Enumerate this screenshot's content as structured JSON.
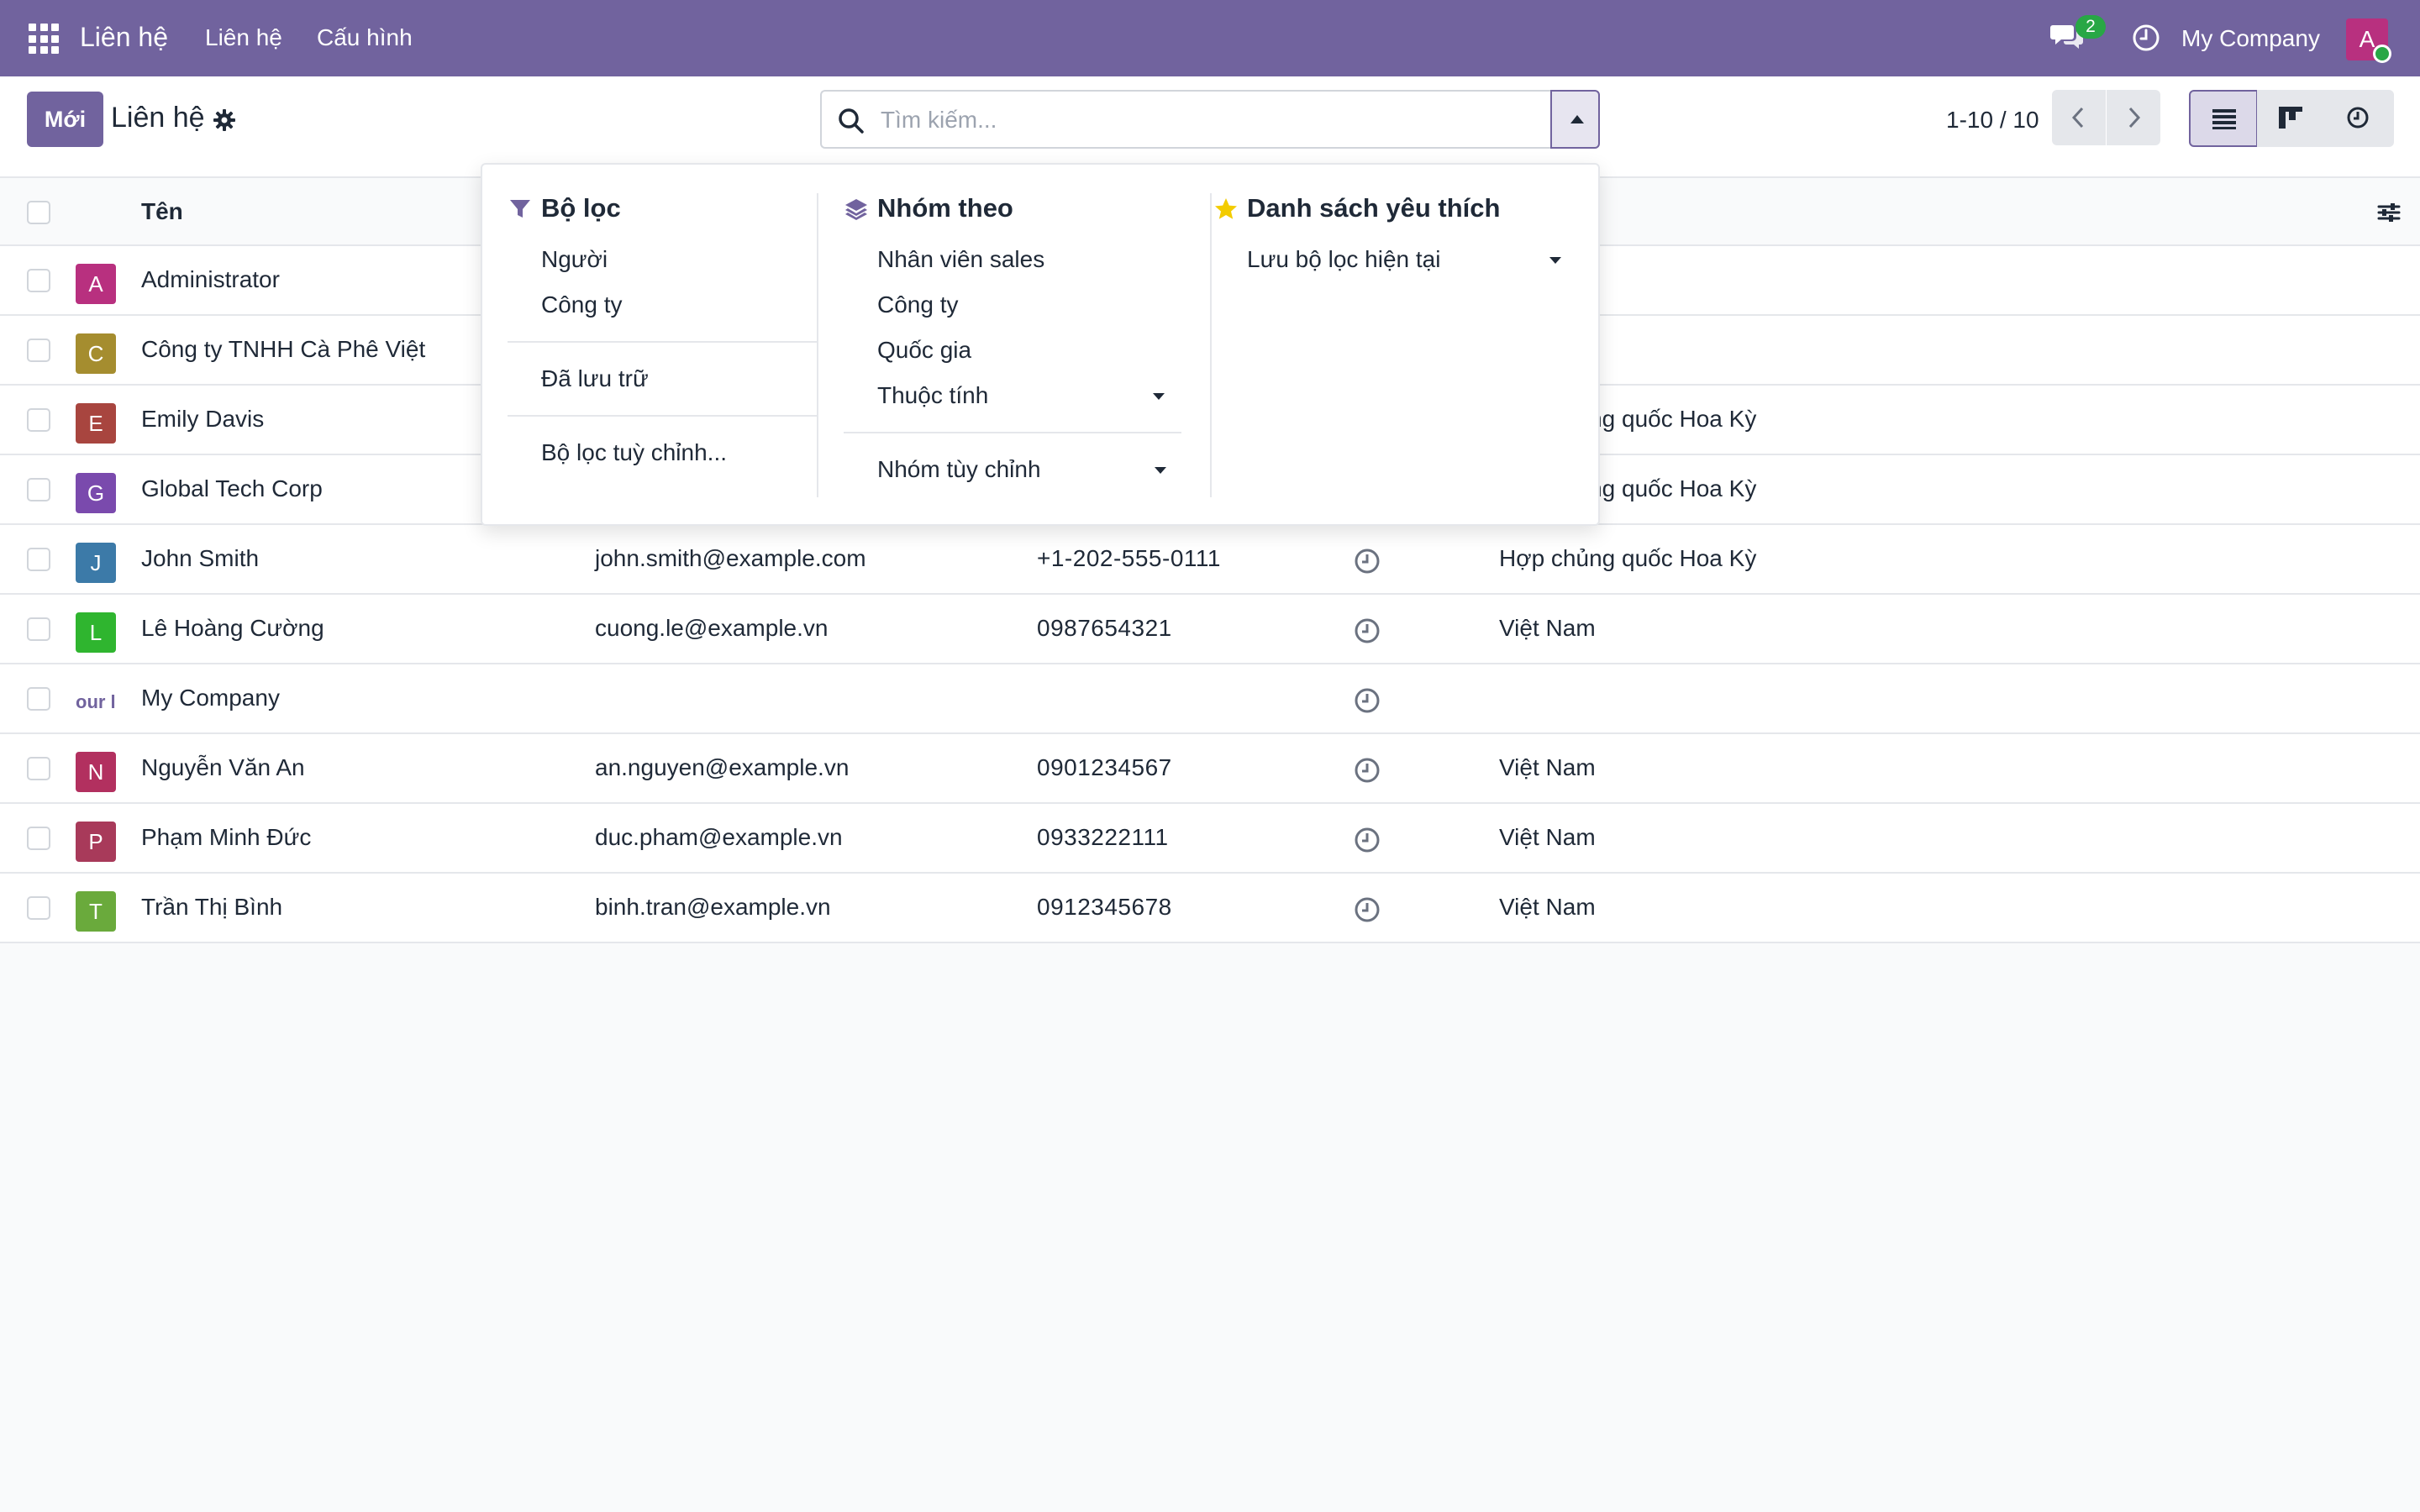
{
  "navbar": {
    "brand": "Liên hệ",
    "menu": [
      "Liên hệ",
      "Cấu hình"
    ],
    "chat_badge": "2",
    "company": "My Company",
    "user_initial": "A"
  },
  "control_panel": {
    "new_label": "Mới",
    "title": "Liên hệ",
    "search_placeholder": "Tìm kiếm...",
    "pager": "1-10 / 10"
  },
  "table": {
    "header_name": "Tên",
    "rows": [
      {
        "initial": "A",
        "color": "#b8307f",
        "name": "Administrator",
        "email": "",
        "phone": "",
        "country": "",
        "activity": false
      },
      {
        "initial": "C",
        "color": "#a58d2f",
        "name": "Công ty TNHH Cà Phê Việt",
        "email": "",
        "phone": "",
        "country": "",
        "activity": false
      },
      {
        "initial": "E",
        "color": "#a8453f",
        "name": "Emily Davis",
        "email": "",
        "phone": "",
        "country": "Hợp chủng quốc Hoa Kỳ",
        "activity": false
      },
      {
        "initial": "G",
        "color": "#7a4aad",
        "name": "Global Tech Corp",
        "email": "",
        "phone": "",
        "country": "Hợp chủng quốc Hoa Kỳ",
        "activity": false
      },
      {
        "initial": "J",
        "color": "#3c7aa8",
        "name": "John Smith",
        "email": "john.smith@example.com",
        "phone": "+1-202-555-0111",
        "country": "Hợp chủng quốc Hoa Kỳ",
        "activity": true
      },
      {
        "initial": "L",
        "color": "#2fb52f",
        "name": "Lê Hoàng Cường",
        "email": "cuong.le@example.vn",
        "phone": "0987654321",
        "country": "Việt Nam",
        "activity": true
      },
      {
        "initial": "our l",
        "color": "logo",
        "name": "My Company",
        "email": "",
        "phone": "",
        "country": "",
        "activity": true
      },
      {
        "initial": "N",
        "color": "#b2305f",
        "name": "Nguyễn Văn An",
        "email": "an.nguyen@example.vn",
        "phone": "0901234567",
        "country": "Việt Nam",
        "activity": true
      },
      {
        "initial": "P",
        "color": "#a83a5a",
        "name": "Phạm Minh Đức",
        "email": "duc.pham@example.vn",
        "phone": "0933222111",
        "country": "Việt Nam",
        "activity": true
      },
      {
        "initial": "T",
        "color": "#6aaa3c",
        "name": "Trần Thị Bình",
        "email": "binh.tran@example.vn",
        "phone": "0912345678",
        "country": "Việt Nam",
        "activity": true
      }
    ]
  },
  "dropdown": {
    "filters": {
      "title": "Bộ lọc",
      "group1": [
        "Người",
        "Công ty"
      ],
      "archived": "Đã lưu trữ",
      "custom": "Bộ lọc tuỳ chỉnh..."
    },
    "groupby": {
      "title": "Nhóm theo",
      "items": [
        "Nhân viên sales",
        "Công ty",
        "Quốc gia"
      ],
      "properties": "Thuộc tính",
      "custom": "Nhóm tùy chỉnh"
    },
    "favorites": {
      "title": "Danh sách yêu thích",
      "save": "Lưu bộ lọc hiện tại"
    }
  },
  "colors": {
    "brand": "#71639e",
    "badge": "#28a745",
    "star": "#f3cc00"
  }
}
